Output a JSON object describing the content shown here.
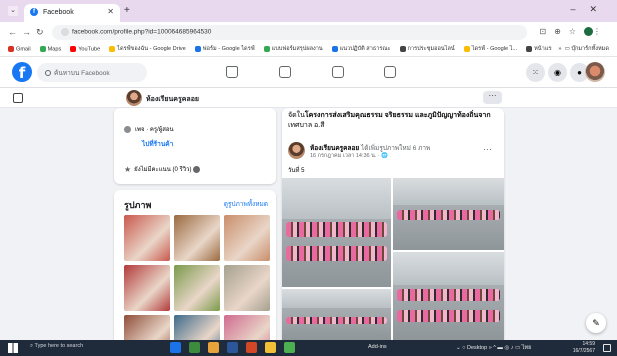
{
  "browser": {
    "tab_title": "Facebook",
    "url": "facebook.com/profile.php?id=100064685964530",
    "bookmarks": [
      {
        "label": "Gmail",
        "color": "#d93025"
      },
      {
        "label": "Maps",
        "color": "#34a853"
      },
      {
        "label": "YouTube",
        "color": "#ff0000"
      },
      {
        "label": "ไดรฟ์ของฉัน - Google Drive",
        "color": "#fbbc04"
      },
      {
        "label": "ฟอร์ม - Google ไดรฟ์",
        "color": "#1a73e8"
      },
      {
        "label": "แบบฟอร์มสรุปผลงาน",
        "color": "#34a853"
      },
      {
        "label": "แนวปฏิบัติ สาธารณะ",
        "color": "#1a73e8"
      },
      {
        "label": "การประชุมออนไลน์",
        "color": "#444444"
      },
      {
        "label": "ไดรฟ์ - Google ไ...",
        "color": "#fbbc04"
      },
      {
        "label": "หน้าแรก",
        "color": "#444444"
      }
    ],
    "bookmarks_right": "บุ๊กมาร์กทั้งหมด"
  },
  "facebook": {
    "search_placeholder": "ค้นหาบน Facebook",
    "page_name": "ห้องเรียนครูคลอย",
    "about": {
      "category": "เพจ · ครู/ผู้สอน",
      "cta": "ไปที่ร้านค้า",
      "rating": "ยังไม่มีคะแนน (0 รีวิว)"
    },
    "photos": {
      "title": "รูปภาพ",
      "see_all": "ดูรูปภาพทั้งหมด",
      "tiles": [
        {
          "color": "#c9584d"
        },
        {
          "color": "#9a6a3f"
        },
        {
          "color": "#c98d6a"
        },
        {
          "color": "#b23a3a"
        },
        {
          "color": "#7a9a4a"
        },
        {
          "color": "#a5a08f"
        },
        {
          "color": "#8f4d3a"
        },
        {
          "color": "#3b6a8a"
        },
        {
          "color": "#d06a8f"
        }
      ]
    },
    "post": {
      "text_prefix": "จัดใน",
      "text_highlight": "โครงการส่งเสริมคุณธรรม จริยธรรม และภูมิปัญญาท้องถิ่นจาก",
      "text_rest": "เทศบาล อ.สี",
      "author": "ห้องเรียนครูคลอย",
      "author_action": "ได้เพิ่มรูปภาพใหม่ 6 ภาพ",
      "date": "16 กรกฎาคม เวลา 14:36 น. · 🌐",
      "tag": "วันที่ 5"
    }
  },
  "taskbar": {
    "search": "Type here to search",
    "middle": "Add-ins",
    "right": "Desktop",
    "time": "14:59",
    "date": "16/7/2567"
  }
}
